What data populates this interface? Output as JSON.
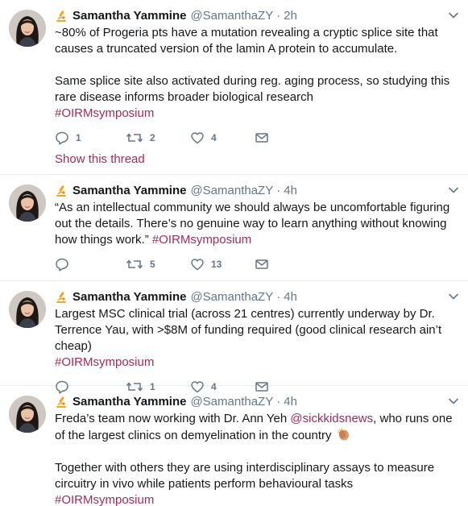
{
  "tweets": [
    {
      "name": "Samantha Yammine",
      "handle": "@SamanthaZY",
      "separator": "·",
      "time": "2h",
      "lines": [
        "~80% of Progeria pts have a mutation revealing a cryptic splice site that causes a truncated version of the lamin A protein to accumulate.",
        "Same splice site also activated during reg. aging process, so studying this rare disease informs broader biological research"
      ],
      "hashtag": "#OIRMsymposium",
      "replies": "1",
      "retweets": "2",
      "likes": "4",
      "show_thread": "Show this thread"
    },
    {
      "name": "Samantha Yammine",
      "handle": "@SamanthaZY",
      "separator": "·",
      "time": "4h",
      "text": "“As an intellectual community we should always be uncomfortable figuring out the details. There’s no genuine way to learn anything without knowing how things work.” ",
      "hashtag": "#OIRMsymposium",
      "replies": "",
      "retweets": "5",
      "likes": "13"
    },
    {
      "name": "Samantha Yammine",
      "handle": "@SamanthaZY",
      "separator": "·",
      "time": "4h",
      "text": "Largest MSC clinical trial (across 21 centres) currently underway by Dr. Terrence Yau, with >$8M of funding required (good clinical research ain’t cheap)",
      "hashtag": "#OIRMsymposium",
      "replies": "",
      "retweets": "1",
      "likes": "4"
    },
    {
      "name": "Samantha Yammine",
      "handle": "@SamanthaZY",
      "separator": "·",
      "time": "4h",
      "text_before": "Freda’s team now working with Dr. Ann Yeh ",
      "mention": "@sickkidsnews",
      "text_after": ", who runs one of the largest clinics on demyelination in the country",
      "text2": "Together with others they are using interdisciplinary assays to measure circuitry in vivo while patients perform behavioural tasks",
      "hashtag": "#OIRMsymposium"
    }
  ],
  "icons": {
    "verified_badge": "microscope-icon",
    "reply": "reply-icon",
    "retweet": "retweet-icon",
    "like": "heart-icon",
    "dm": "envelope-icon",
    "menu": "chevron-down-icon",
    "emoji": "clapping-hands-icon"
  },
  "colors": {
    "link": "#a02c5b",
    "muted": "#657786",
    "text": "#14171a"
  }
}
